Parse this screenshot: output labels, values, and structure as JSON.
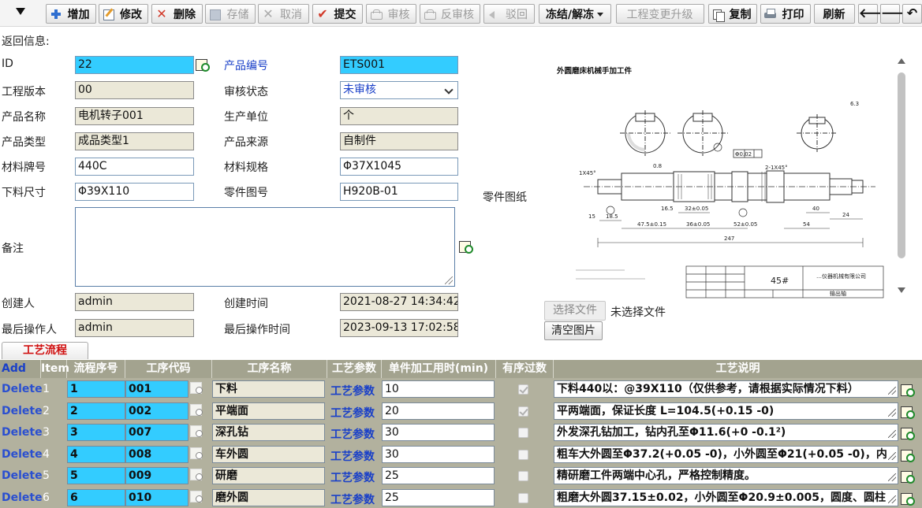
{
  "toolbar": {
    "add": "增加",
    "edit": "修改",
    "delete": "删除",
    "save": "存储",
    "cancel": "取消",
    "submit": "提交",
    "audit": "审核",
    "unaudit": "反审核",
    "reject": "驳回",
    "freeze": "冻结/解冻",
    "upgrade": "工程变更升级",
    "copy": "复制",
    "print": "打印",
    "refresh": "刷新",
    "prev": "🡐",
    "next": "🡒",
    "undo": "↶"
  },
  "return_info": "返回信息:",
  "form": {
    "id_label": "ID",
    "id_value": "22",
    "product_code_label": "产品编号",
    "product_code_value": "ETS001",
    "version_label": "工程版本",
    "version_value": "00",
    "audit_status_label": "审核状态",
    "audit_status_value": "未审核",
    "product_name_label": "产品名称",
    "product_name_value": "电机转子001",
    "unit_label": "生产单位",
    "unit_value": "个",
    "product_type_label": "产品类型",
    "product_type_value": "成品类型1",
    "product_source_label": "产品来源",
    "product_source_value": "自制件",
    "material_grade_label": "材料牌号",
    "material_grade_value": "440C",
    "material_spec_label": "材料规格",
    "material_spec_value": "Φ37X1045",
    "cut_size_label": "下料尺寸",
    "cut_size_value": "Φ39X110",
    "drawing_no_label": "零件图号",
    "drawing_no_value": "H920B-01",
    "remark_label": "备注",
    "remark_value": "",
    "creator_label": "创建人",
    "creator_value": "admin",
    "created_time_label": "创建时间",
    "created_time_value": "2021-08-27 14:34:42",
    "last_operator_label": "最后操作人",
    "last_operator_value": "admin",
    "last_op_time_label": "最后操作时间",
    "last_op_time_value": "2023-09-13 17:02:58"
  },
  "drawing": {
    "label": "零件图纸",
    "title": "外圆磨床机械手加工件",
    "choose_file": "选择文件",
    "no_file": "未选择文件",
    "clear": "清空图片",
    "material_mark": "45#",
    "company": "…仪器机械有限公司",
    "part_name": "输出轴",
    "dims": [
      "247",
      "54",
      "40",
      "24",
      "47.5±0.15",
      "36±0.05",
      "52±0.05",
      "16.5",
      "32±0.05",
      "18.5",
      "15",
      "1X45°",
      "2-1X45°",
      "0.8",
      "6.3",
      "Φ0.02"
    ]
  },
  "tab": {
    "label": "工艺流程"
  },
  "grid": {
    "headers": {
      "add": "Add",
      "item": "Item",
      "seq": "流程序号",
      "code": "工序代码",
      "name": "工序名称",
      "params": "工艺参数",
      "time": "单件加工用时(min)",
      "ordered": "有序过数",
      "desc": "工艺说明"
    },
    "rows": [
      {
        "del": "Delete",
        "item": "1",
        "seq": "1",
        "code": "001",
        "name": "下料",
        "params": "工艺参数",
        "time": "10",
        "ordered": true,
        "desc": "下料440以：@39X110（仅供参考，请根据实际情况下料）"
      },
      {
        "del": "Delete",
        "item": "2",
        "seq": "2",
        "code": "002",
        "name": "平端面",
        "params": "工艺参数",
        "time": "20",
        "ordered": true,
        "desc": "平两端面，保证长度 L=104.5(+0.15  -0)"
      },
      {
        "del": "Delete",
        "item": "3",
        "seq": "3",
        "code": "007",
        "name": "深孔钻",
        "params": "工艺参数",
        "time": "30",
        "ordered": false,
        "desc": "外发深孔钻加工，钻内孔至Φ11.6(+0 -0.1²)"
      },
      {
        "del": "Delete",
        "item": "4",
        "seq": "4",
        "code": "008",
        "name": "车外圆",
        "params": "工艺参数",
        "time": "30",
        "ordered": false,
        "desc": "粗车大外圆至Φ37.2(+0.05 -0)，小外圆至Φ21(+0.05 -0)，内"
      },
      {
        "del": "Delete",
        "item": "5",
        "seq": "5",
        "code": "009",
        "name": "研磨",
        "params": "工艺参数",
        "time": "25",
        "ordered": false,
        "desc": "精研磨工件两端中心孔，严格控制精度。"
      },
      {
        "del": "Delete",
        "item": "6",
        "seq": "6",
        "code": "010",
        "name": "磨外圆",
        "params": "工艺参数",
        "time": "25",
        "ordered": false,
        "desc": "粗磨大外圆37.15±0.02，小外圆至Φ20.9±0.005，圆度、圆柱"
      }
    ]
  }
}
